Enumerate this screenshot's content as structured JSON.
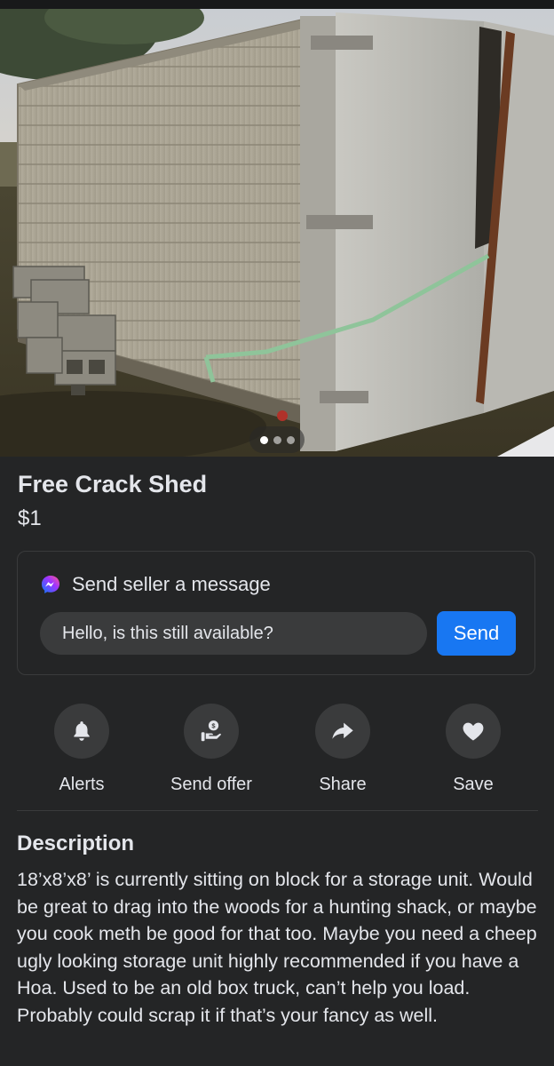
{
  "listing": {
    "title": "Free Crack Shed",
    "price": "$1",
    "photo_description_icon": "photo-carousel",
    "carousel": {
      "total": 3,
      "active": 1
    }
  },
  "message_card": {
    "header": "Send seller a message",
    "input_value": "Hello, is this still available?",
    "send_label": "Send",
    "accent_color": "#1877f2"
  },
  "actions": [
    {
      "label": "Alerts",
      "icon": "bell-icon"
    },
    {
      "label": "Send offer",
      "icon": "offer-icon"
    },
    {
      "label": "Share",
      "icon": "share-arrow-icon"
    },
    {
      "label": "Save",
      "icon": "heart-icon"
    }
  ],
  "description": {
    "heading": "Description",
    "text": "18’x8’x8’ is currently sitting on block for a storage unit. Would be great to drag into the woods for a hunting shack, or maybe you cook meth be good for that too. Maybe you need a cheep ugly looking storage unit highly recommended if you have a Hoa. Used to be an old box truck, can’t help you load. Probably could scrap it if that’s your fancy as well."
  }
}
